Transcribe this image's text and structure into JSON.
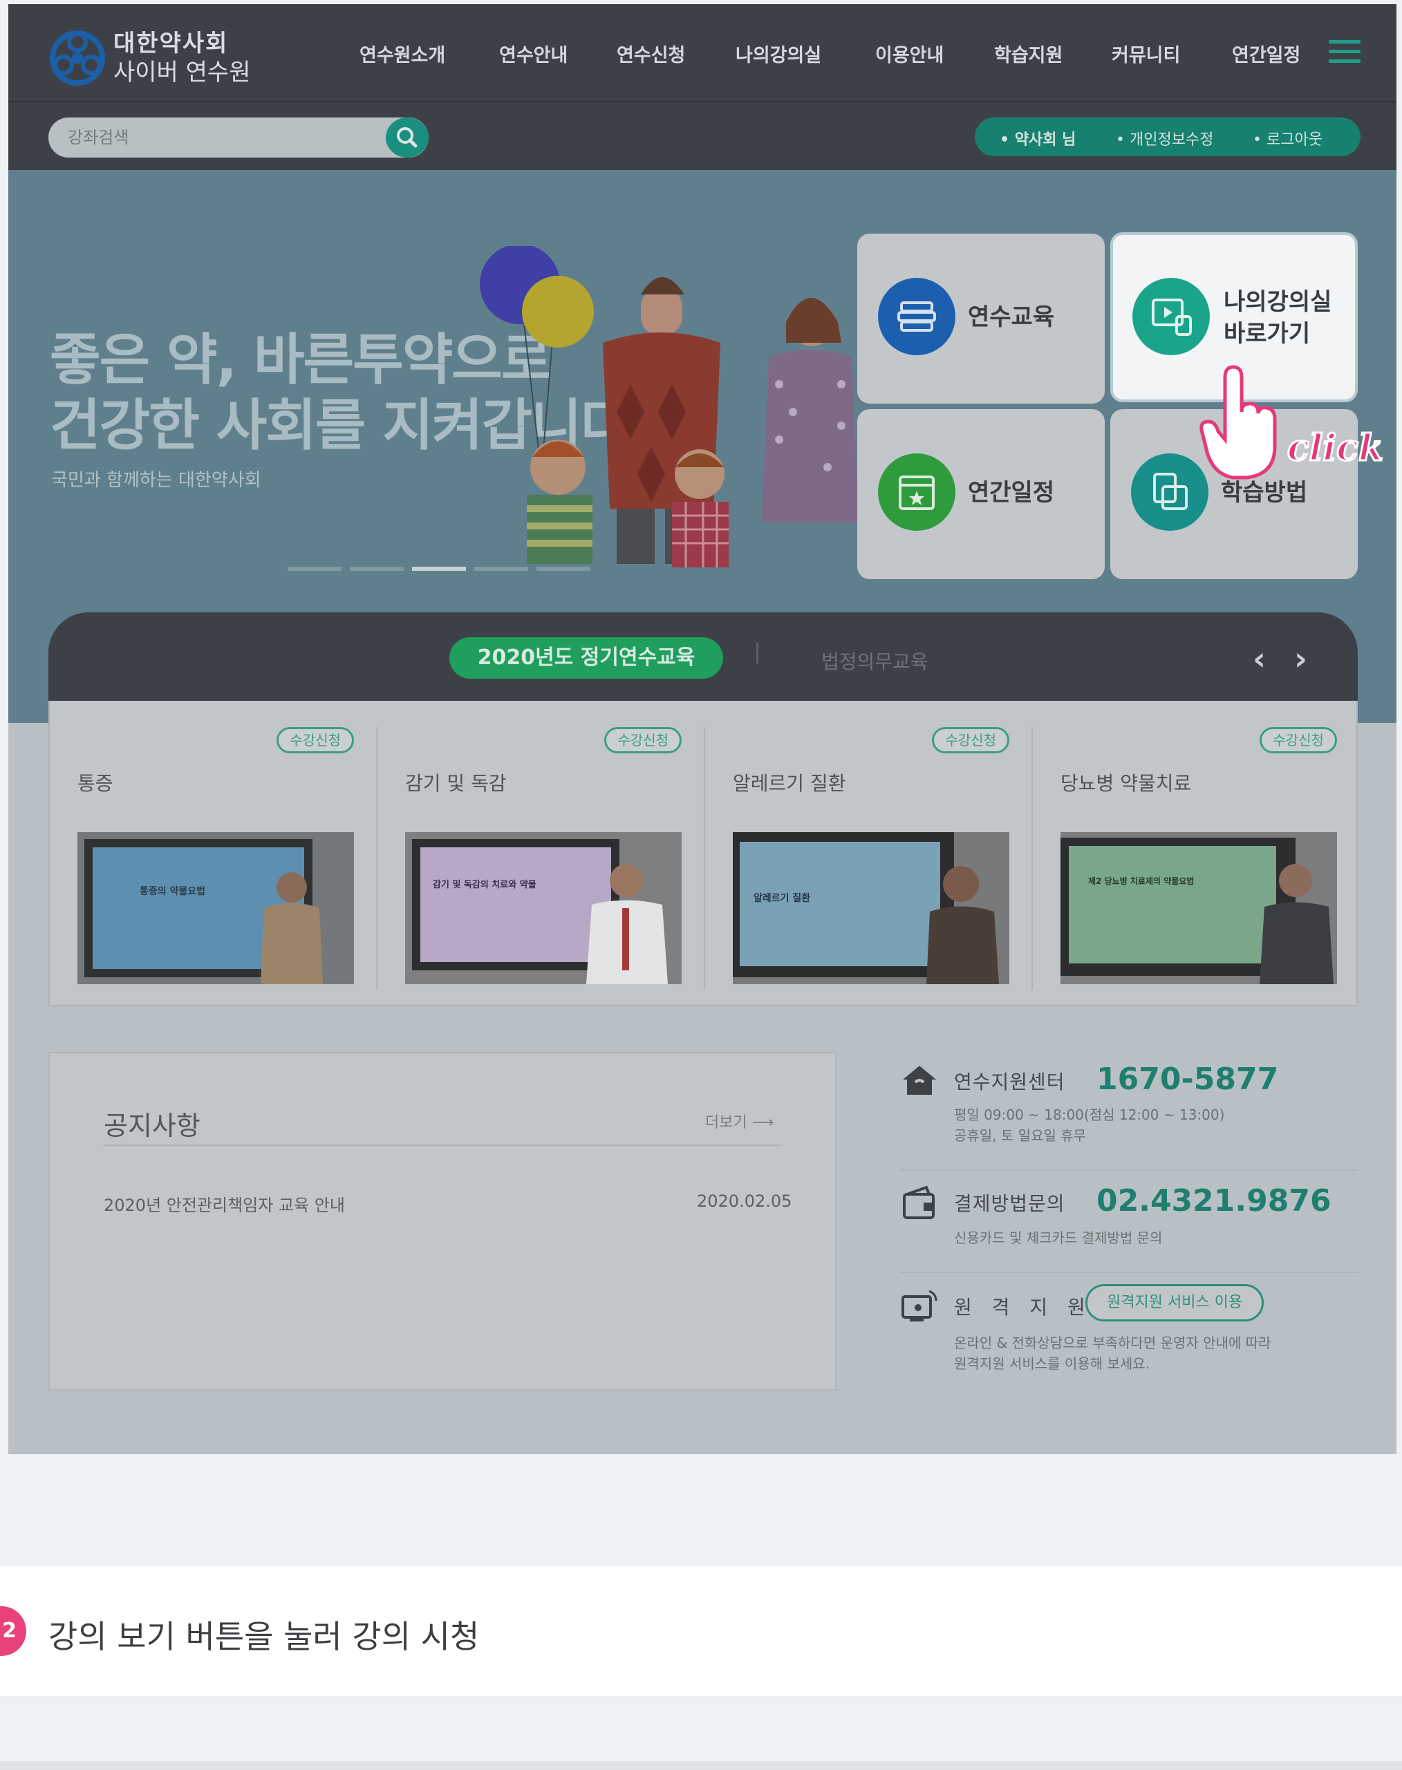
{
  "header": {
    "logo_line1": "대한약사회",
    "logo_line2": "사이버 연수원",
    "nav": [
      "연수원소개",
      "연수안내",
      "연수신청",
      "나의강의실",
      "이용안내",
      "학습지원",
      "커뮤니티",
      "연간일정"
    ]
  },
  "search": {
    "placeholder": "강좌검색"
  },
  "user": {
    "links": [
      "• 약사회 님",
      "• 개인정보수정",
      "• 로그아웃"
    ]
  },
  "hero": {
    "title_line1": "좋은 약, 바른투약으로",
    "title_line2": "건강한 사회를 지켜갑니다",
    "subtitle": "국민과 함께하는 대한약사회",
    "slide_count": 5,
    "active_slide": 3
  },
  "quick_links": [
    {
      "label": "연수교육",
      "icon": "books-icon",
      "color": "#1c5fae"
    },
    {
      "label": "나의강의실\n바로가기",
      "icon": "video-player-icon",
      "color": "#1aa58a"
    },
    {
      "label": "연간일정",
      "icon": "calendar-icon",
      "color": "#2e9b3d"
    },
    {
      "label": "학습방법",
      "icon": "study-icon",
      "color": "#188f8a"
    }
  ],
  "click_annotation": "click",
  "courses": {
    "tab_active": "2020년도 정기연수교육",
    "tab_other": "법정의무교육",
    "prev": "‹",
    "next": "›",
    "badge_label": "수강신청",
    "items": [
      {
        "title": "통증",
        "slide_text": "통증의 약물요법"
      },
      {
        "title": "감기 및 독감",
        "slide_text": "감기 및 독감의 치료와 약물"
      },
      {
        "title": "알레르기 질환",
        "slide_text": "알레르기 질환"
      },
      {
        "title": "당뇨병 약물치료",
        "slide_text": "제2 당뇨병 치료제의 약물요법"
      }
    ]
  },
  "notice": {
    "title": "공지사항",
    "more": "더보기",
    "rows": [
      {
        "title": "2020년 안전관리책임자 교육 안내",
        "date": "2020.02.05"
      }
    ]
  },
  "contacts": [
    {
      "label": "연수지원센터",
      "number": "1670-5877",
      "desc": [
        "평일 09:00 ~ 18:00(점심 12:00 ~ 13:00)",
        "공휴일, 토 일요일 휴무"
      ]
    },
    {
      "label": "결제방법문의",
      "number": "02.4321.9876",
      "desc": [
        "신용카드 및 체크카드 결제방법 문의"
      ]
    },
    {
      "label": "원 격 지 원",
      "button": "원격지원 서비스 이용",
      "desc": [
        "온라인 & 전화상담으로 부족하다면 운영자 안내에 따라",
        "원격지원 서비스를 이용해 보세요."
      ]
    }
  ],
  "step": {
    "number": "2",
    "text": "강의 보기 버튼을 눌러 강의 시청"
  },
  "colors": {
    "accent": "#1f9e5e",
    "teal": "#17806f",
    "pink": "#e8417c"
  }
}
